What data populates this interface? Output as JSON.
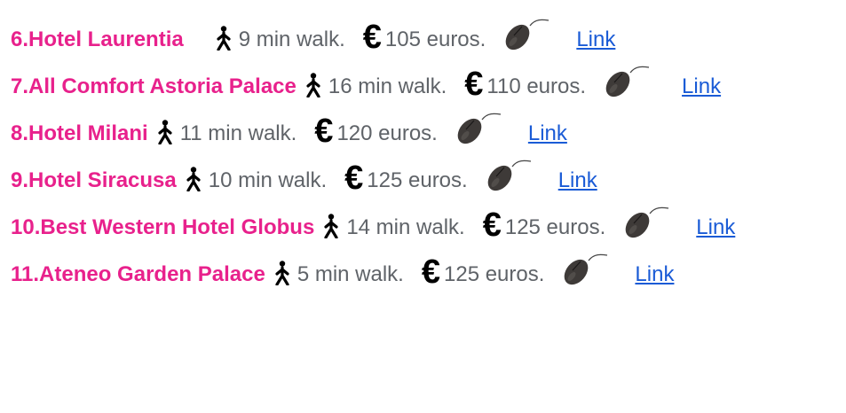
{
  "hotels": [
    {
      "name": "6.Hotel Laurentia",
      "walk": "9 min walk.",
      "currency_symbol": "€",
      "price": "105 euros.",
      "link_label": "Link"
    },
    {
      "name": "7.All Comfort Astoria Palace",
      "walk": "16 min walk.",
      "currency_symbol": "€",
      "price": "110 euros.",
      "link_label": "Link"
    },
    {
      "name": "8.Hotel Milani",
      "walk": "11 min walk.",
      "currency_symbol": "€",
      "price": "120 euros.",
      "link_label": "Link"
    },
    {
      "name": "9.Hotel Siracusa",
      "walk": "10 min walk.",
      "currency_symbol": "€",
      "price": "125 euros.",
      "link_label": "Link"
    },
    {
      "name": "10.Best Western Hotel Globus",
      "walk": "14 min walk.",
      "currency_symbol": "€",
      "price": "125 euros.",
      "link_label": "Link"
    },
    {
      "name": "11.Ateneo Garden Palace",
      "walk": "5 min walk.",
      "currency_symbol": "€",
      "price": "125 euros.",
      "link_label": "Link"
    }
  ],
  "icons": {
    "walk": "walking-person-icon",
    "mouse": "computer-mouse-icon"
  },
  "colors": {
    "hotel_name": "#e8218c",
    "body_text": "#5f6368",
    "link": "#1a5bd6"
  }
}
